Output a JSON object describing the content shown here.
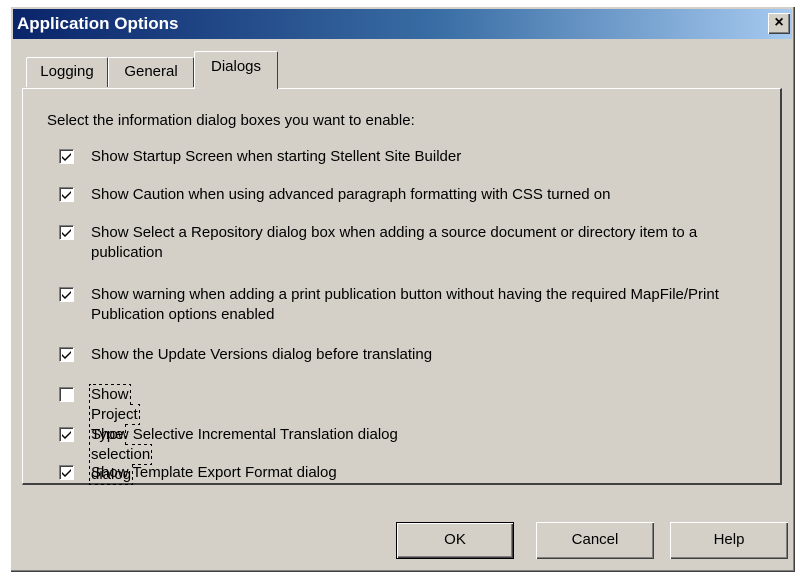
{
  "window": {
    "title": "Application Options",
    "close_label": "×"
  },
  "tabs": [
    {
      "label": "Logging",
      "active": false
    },
    {
      "label": "General",
      "active": false
    },
    {
      "label": "Dialogs",
      "active": true
    }
  ],
  "dialogs_tab": {
    "intro": "Select the information dialog boxes you want to enable:",
    "options": [
      {
        "label": "Show Startup Screen when starting Stellent Site Builder",
        "checked": true
      },
      {
        "label": "Show Caution when using advanced paragraph formatting with CSS turned on",
        "checked": true
      },
      {
        "label": "Show Select a Repository dialog box when adding a source document or directory item to a publication",
        "checked": true
      },
      {
        "label": "Show warning when adding a print publication button without having the required MapFile/Print Publication options enabled",
        "checked": true
      },
      {
        "label": "Show the Update Versions dialog before translating",
        "checked": true
      },
      {
        "label": "Show Project Type selection dialog",
        "checked": false
      },
      {
        "label": "Show Selective Incremental Translation dialog",
        "checked": true
      },
      {
        "label": "Show Template Export Format dialog",
        "checked": true
      }
    ]
  },
  "buttons": {
    "ok": "OK",
    "cancel": "Cancel",
    "help": "Help"
  }
}
